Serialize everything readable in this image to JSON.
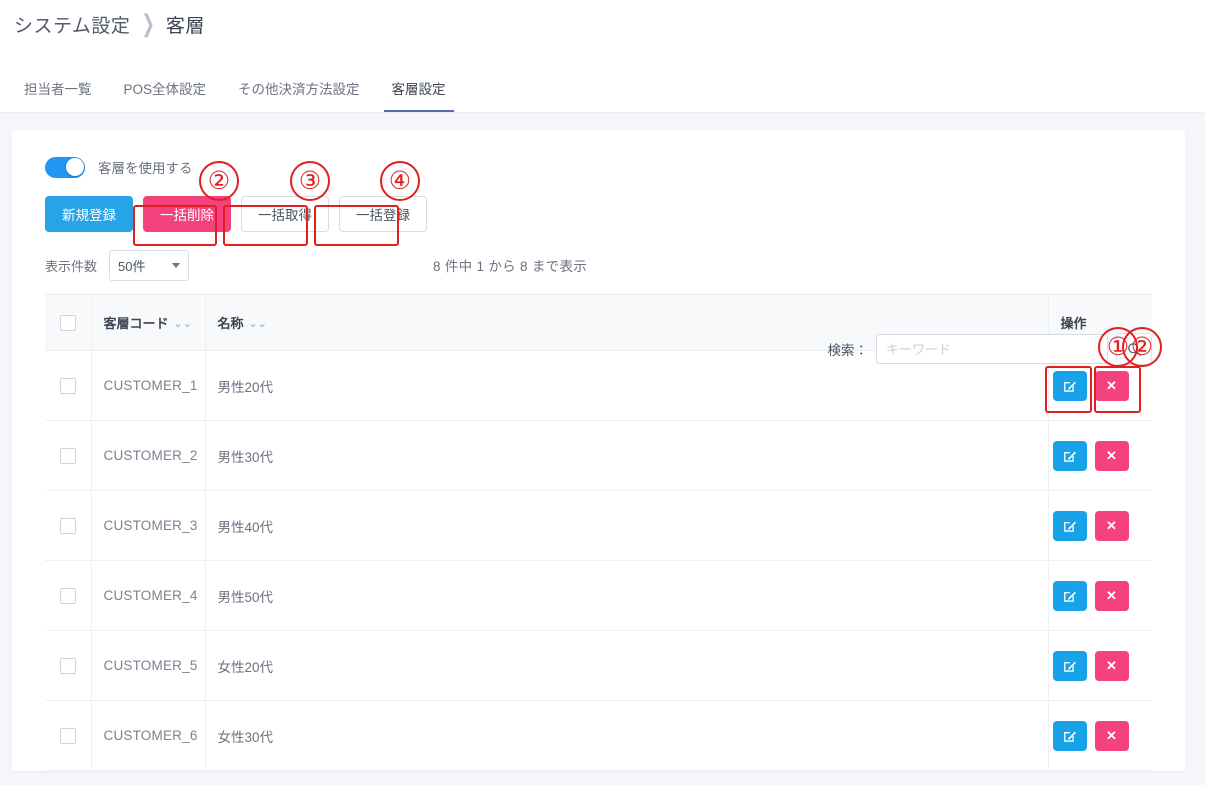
{
  "breadcrumb": {
    "root": "システム設定",
    "separator": "❯",
    "current": "客層"
  },
  "tabs": [
    {
      "label": "担当者一覧",
      "active": false
    },
    {
      "label": "POS全体設定",
      "active": false
    },
    {
      "label": "その他決済方法設定",
      "active": false
    },
    {
      "label": "客層設定",
      "active": true
    }
  ],
  "toggle": {
    "label": "客層を使用する",
    "state": "on",
    "color": "#2196f3"
  },
  "buttons": {
    "new": "新規登録",
    "bulk_delete": "一括削除",
    "bulk_get": "一括取得",
    "bulk_register": "一括登録"
  },
  "colors": {
    "primary": "#27a3e8",
    "danger": "#f4427f",
    "edit": "#18a2e8",
    "annotation": "#e02020",
    "tab_active_underline": "#5b6ba8"
  },
  "list_controls": {
    "rows_label": "表示件数",
    "rows_value": "50件",
    "rows_options": [
      "50件"
    ],
    "info_text": "8 件中 1 から 8 まで表示"
  },
  "search": {
    "label": "検索：",
    "value": "",
    "placeholder": "キーワード",
    "button_icon": "search-icon"
  },
  "table": {
    "columns": {
      "check": "",
      "code": "客層コード",
      "name": "名称",
      "ops": "操作"
    },
    "sort_icon": "chevron-double-down-icon",
    "rows": [
      {
        "code": "CUSTOMER_1",
        "name": "男性20代"
      },
      {
        "code": "CUSTOMER_2",
        "name": "男性30代"
      },
      {
        "code": "CUSTOMER_3",
        "name": "男性40代"
      },
      {
        "code": "CUSTOMER_4",
        "name": "男性50代"
      },
      {
        "code": "CUSTOMER_5",
        "name": "女性20代"
      },
      {
        "code": "CUSTOMER_6",
        "name": "女性30代"
      }
    ],
    "row_actions": {
      "edit_icon": "edit-pencil-icon",
      "delete_icon": "close-x-icon"
    }
  },
  "annotations": {
    "numbers": [
      {
        "label": "①",
        "target": "row-edit-button"
      },
      {
        "label": "②",
        "target": "row-delete-button"
      },
      {
        "label": "②",
        "target": "bulk-delete-button"
      },
      {
        "label": "③",
        "target": "bulk-get-button"
      },
      {
        "label": "④",
        "target": "bulk-register-button"
      }
    ]
  }
}
